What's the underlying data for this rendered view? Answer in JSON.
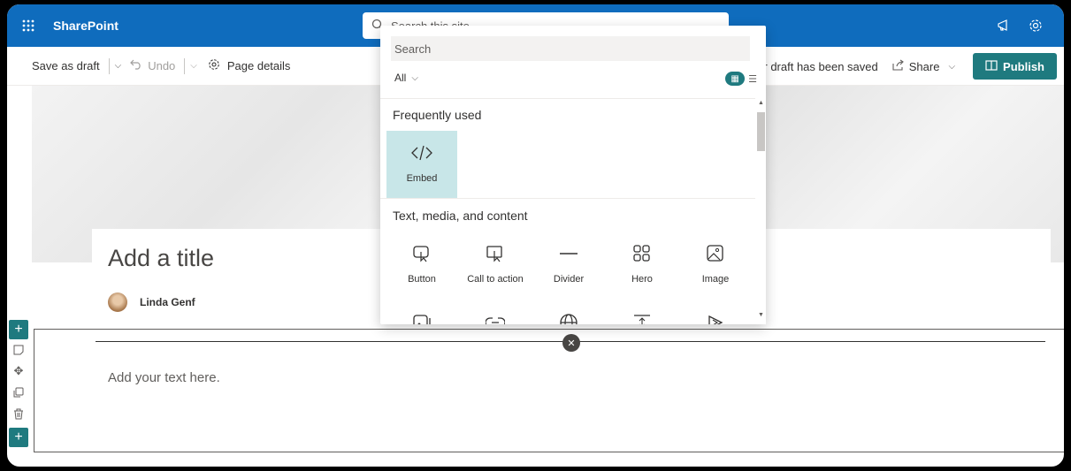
{
  "suitebar": {
    "app_name": "SharePoint",
    "search_placeholder": "Search this site"
  },
  "cmdbar": {
    "save_as_draft": "Save as draft",
    "undo": "Undo",
    "page_details": "Page details",
    "draft_status": "Your draft has been saved",
    "share": "Share",
    "publish": "Publish"
  },
  "page": {
    "title_placeholder": "Add a title",
    "author": "Linda Genf",
    "text_placeholder": "Add your text here."
  },
  "toolbox": {
    "search_placeholder": "Search",
    "filter": "All",
    "frequently_used_title": "Frequently used",
    "frequently_used": [
      {
        "label": "Embed",
        "icon": "embed-icon"
      }
    ],
    "text_media_title": "Text, media, and content",
    "text_media": [
      {
        "label": "Button",
        "icon": "button-icon"
      },
      {
        "label": "Call to action",
        "icon": "call-to-action-icon"
      },
      {
        "label": "Divider",
        "icon": "divider-icon"
      },
      {
        "label": "Hero",
        "icon": "hero-icon"
      },
      {
        "label": "Image",
        "icon": "image-icon"
      }
    ]
  },
  "colors": {
    "suite_blue": "#0f6cbd",
    "accent_teal": "#1f7a7f",
    "selected_tile": "#c8e6e8"
  }
}
